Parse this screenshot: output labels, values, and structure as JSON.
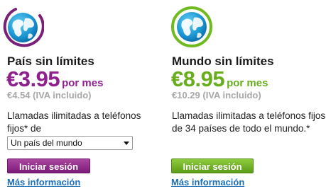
{
  "colors": {
    "purple_accent": "#8f1f8e",
    "green_accent": "#67ad1c",
    "link": "#1d6fb8",
    "vat_gray": "#a8a8a8"
  },
  "plans": [
    {
      "icon": "globe-icon",
      "name": "País sin límites",
      "price": "€3.95",
      "price_unit": "por mes",
      "price_vat": "€4.54 (IVA incluido)",
      "description": "Llamadas ilimitadas a teléfonos fijos* de",
      "select_value": "Un país del mundo",
      "button_label": "Iniciar sesión",
      "link_label": "Más información"
    },
    {
      "icon": "globe-icon",
      "name": "Mundo sin límites",
      "price": "€8.95",
      "price_unit": "por mes",
      "price_vat": "€10.29 (IVA incluido)",
      "description": "Llamadas ilimitadas a teléfonos fijos de 34 países de todo el mundo.*",
      "button_label": "Iniciar sesión",
      "link_label": "Más información"
    }
  ]
}
